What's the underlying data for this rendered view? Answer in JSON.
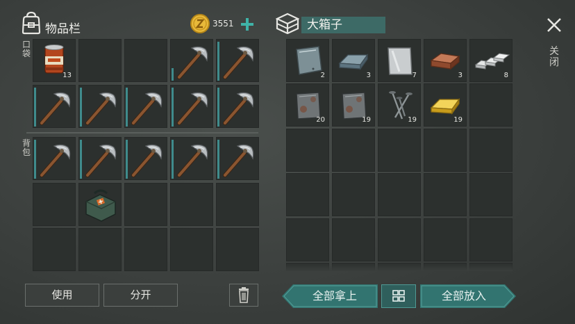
{
  "header": {
    "inventory_title": "物品栏",
    "coins": "3551",
    "add_coins_icon": "plus-icon",
    "chest_name": "大箱子",
    "close_label": "关闭"
  },
  "labels": {
    "pocket": "口袋",
    "backpack": "背包"
  },
  "buttons": {
    "use": "使用",
    "split": "分开",
    "take_all": "全部拿上",
    "put_all": "全部放入"
  },
  "pocket_slots": [
    {
      "item": "canned-food",
      "count": "13"
    },
    {
      "item": "empty"
    },
    {
      "item": "empty"
    },
    {
      "item": "pickaxe",
      "durability": "low"
    },
    {
      "item": "pickaxe",
      "durability": "full"
    },
    {
      "item": "pickaxe",
      "durability": "full"
    },
    {
      "item": "pickaxe",
      "durability": "full"
    },
    {
      "item": "pickaxe",
      "durability": "full"
    },
    {
      "item": "pickaxe",
      "durability": "full"
    },
    {
      "item": "pickaxe",
      "durability": "full"
    }
  ],
  "backpack_slots": [
    {
      "item": "pickaxe",
      "durability": "full"
    },
    {
      "item": "pickaxe",
      "durability": "full"
    },
    {
      "item": "pickaxe",
      "durability": "full"
    },
    {
      "item": "pickaxe",
      "durability": "full"
    },
    {
      "item": "pickaxe",
      "durability": "full"
    },
    {
      "item": "empty"
    },
    {
      "item": "medkit-bag"
    },
    {
      "item": "empty"
    },
    {
      "item": "empty"
    },
    {
      "item": "empty"
    },
    {
      "item": "empty"
    },
    {
      "item": "empty"
    },
    {
      "item": "empty"
    },
    {
      "item": "empty"
    },
    {
      "item": "empty"
    }
  ],
  "chest_slots": [
    {
      "item": "iron-plate",
      "count": "2"
    },
    {
      "item": "iron-ingot",
      "count": "3"
    },
    {
      "item": "steel-plate",
      "count": "7"
    },
    {
      "item": "copper-ingot",
      "count": "3"
    },
    {
      "item": "aluminum-ingots",
      "count": "8"
    },
    {
      "item": "rusty-iron-plate",
      "count": "20"
    },
    {
      "item": "rusty-iron-plate",
      "count": "19"
    },
    {
      "item": "nails",
      "count": "19"
    },
    {
      "item": "gold-ingot",
      "count": "19"
    }
  ],
  "colors": {
    "accent": "#327470",
    "durability": "#3f8b8c",
    "coin": "#e8b93a"
  }
}
